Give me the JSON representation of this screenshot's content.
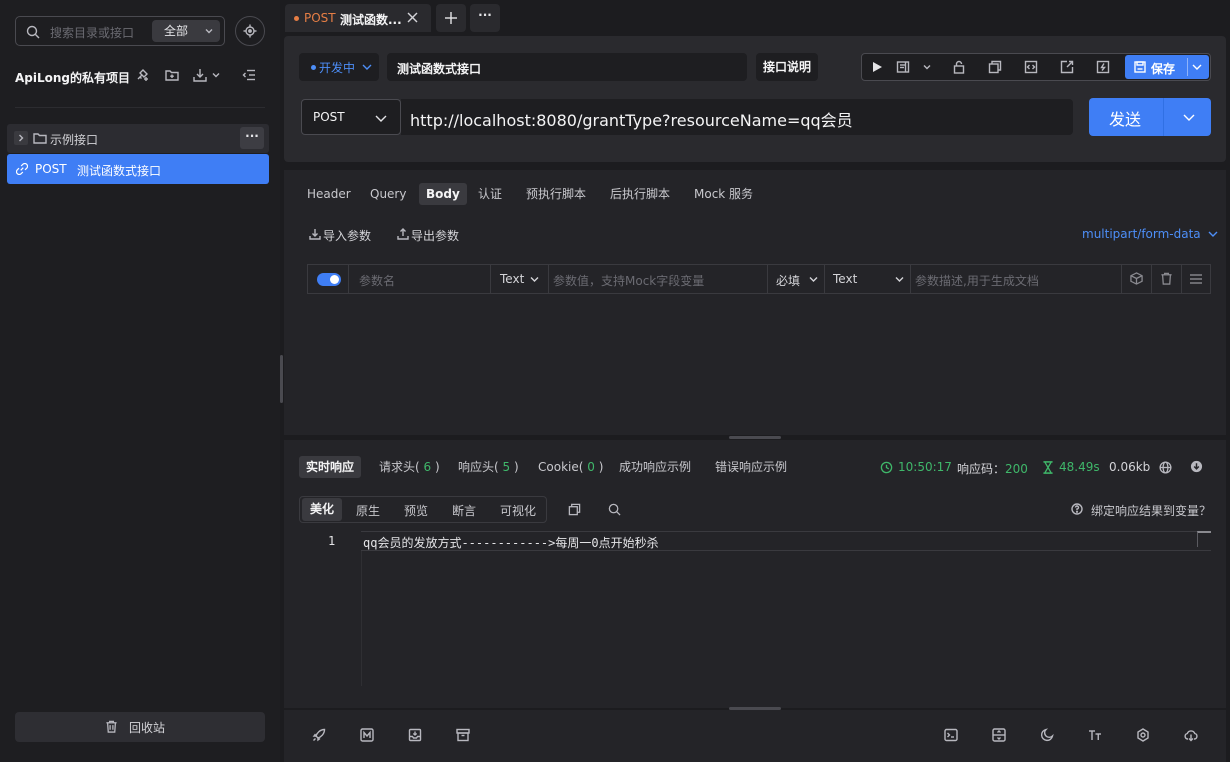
{
  "sidebar": {
    "search_placeholder": "搜索目录或接口",
    "scope": "全部",
    "project_title": "ApiLong的私有项目",
    "folder_label": "示例接口",
    "folder_more": "···",
    "api_item": {
      "method": "POST",
      "name": "测试函数式接口"
    },
    "trash_label": "回收站"
  },
  "tabs": {
    "active": {
      "method": "POST",
      "name": "测试函数..."
    },
    "more": "···"
  },
  "request": {
    "env": "开发中",
    "api_name": "测试函数式接口",
    "doc_button": "接口说明",
    "save_label": "保存",
    "method": "POST",
    "url": "http://localhost:8080/grantType?resourceName=qq会员",
    "send_label": "发送",
    "tabs": [
      "Header",
      "Query",
      "Body",
      "认证",
      "预执行脚本",
      "后执行脚本",
      "Mock 服务"
    ],
    "active_tab": "Body",
    "import_label": "导入参数",
    "export_label": "导出参数",
    "content_type": "multipart/form-data",
    "param_row": {
      "enabled": true,
      "name_placeholder": "参数名",
      "type": "Text",
      "value_placeholder": "参数值，支持Mock字段变量",
      "required": "必填",
      "field_type": "Text",
      "desc_placeholder": "参数描述,用于生成文档"
    }
  },
  "response": {
    "tabs": [
      {
        "label": "实时响应"
      },
      {
        "label": "请求头",
        "count": "6"
      },
      {
        "label": "响应头",
        "count": "5"
      },
      {
        "label": "Cookie",
        "count": "0"
      },
      {
        "label": "成功响应示例"
      },
      {
        "label": "错误响应示例"
      }
    ],
    "time": "10:50:17",
    "code_label": "响应码：",
    "code": "200",
    "duration": "48.49s",
    "size": "0.06kb",
    "views": [
      "美化",
      "原生",
      "预览",
      "断言",
      "可视化"
    ],
    "active_view": "美化",
    "bind_label": "绑定响应结果到变量？",
    "line_number": "1",
    "body": "qq会员的发放方式------------>每周一0点开始秒杀"
  },
  "colors": {
    "accent": "#3f7ef5",
    "success": "#3fb76a",
    "post": "#e67e45"
  }
}
